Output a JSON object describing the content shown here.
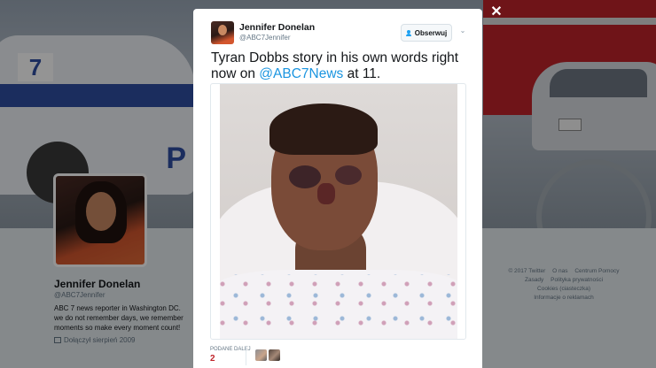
{
  "profile": {
    "name": "Jennifer Donelan",
    "handle": "@ABC7Jennifer",
    "bio": "ABC 7 news reporter in Washington DC. we do not remember days, we remember moments so make every moment count!",
    "joined": "Dołączył sierpień 2009"
  },
  "footer": {
    "links": [
      "© 2017 Twitter",
      "O nas",
      "Centrum Pomocy",
      "Zasady",
      "Polityka prywatności",
      "Cookies (ciasteczka)",
      "Informacje o reklamach"
    ]
  },
  "modal": {
    "close_icon": "close-icon",
    "author": {
      "name": "Jennifer Donelan",
      "handle": "@ABC7Jennifer"
    },
    "follow_label": "Obserwuj",
    "tweet": {
      "text_before": "Tyran Dobbs story in his own words right now on ",
      "mention": "@ABC7News",
      "text_after": " at 11."
    },
    "stats": {
      "retweets_label": "PODANE DALEJ",
      "retweets_count": "2"
    }
  },
  "colors": {
    "link": "#1b95e0",
    "retweet_count": "#c0242a",
    "overlay": "rgba(0,0,0,0.42)"
  }
}
